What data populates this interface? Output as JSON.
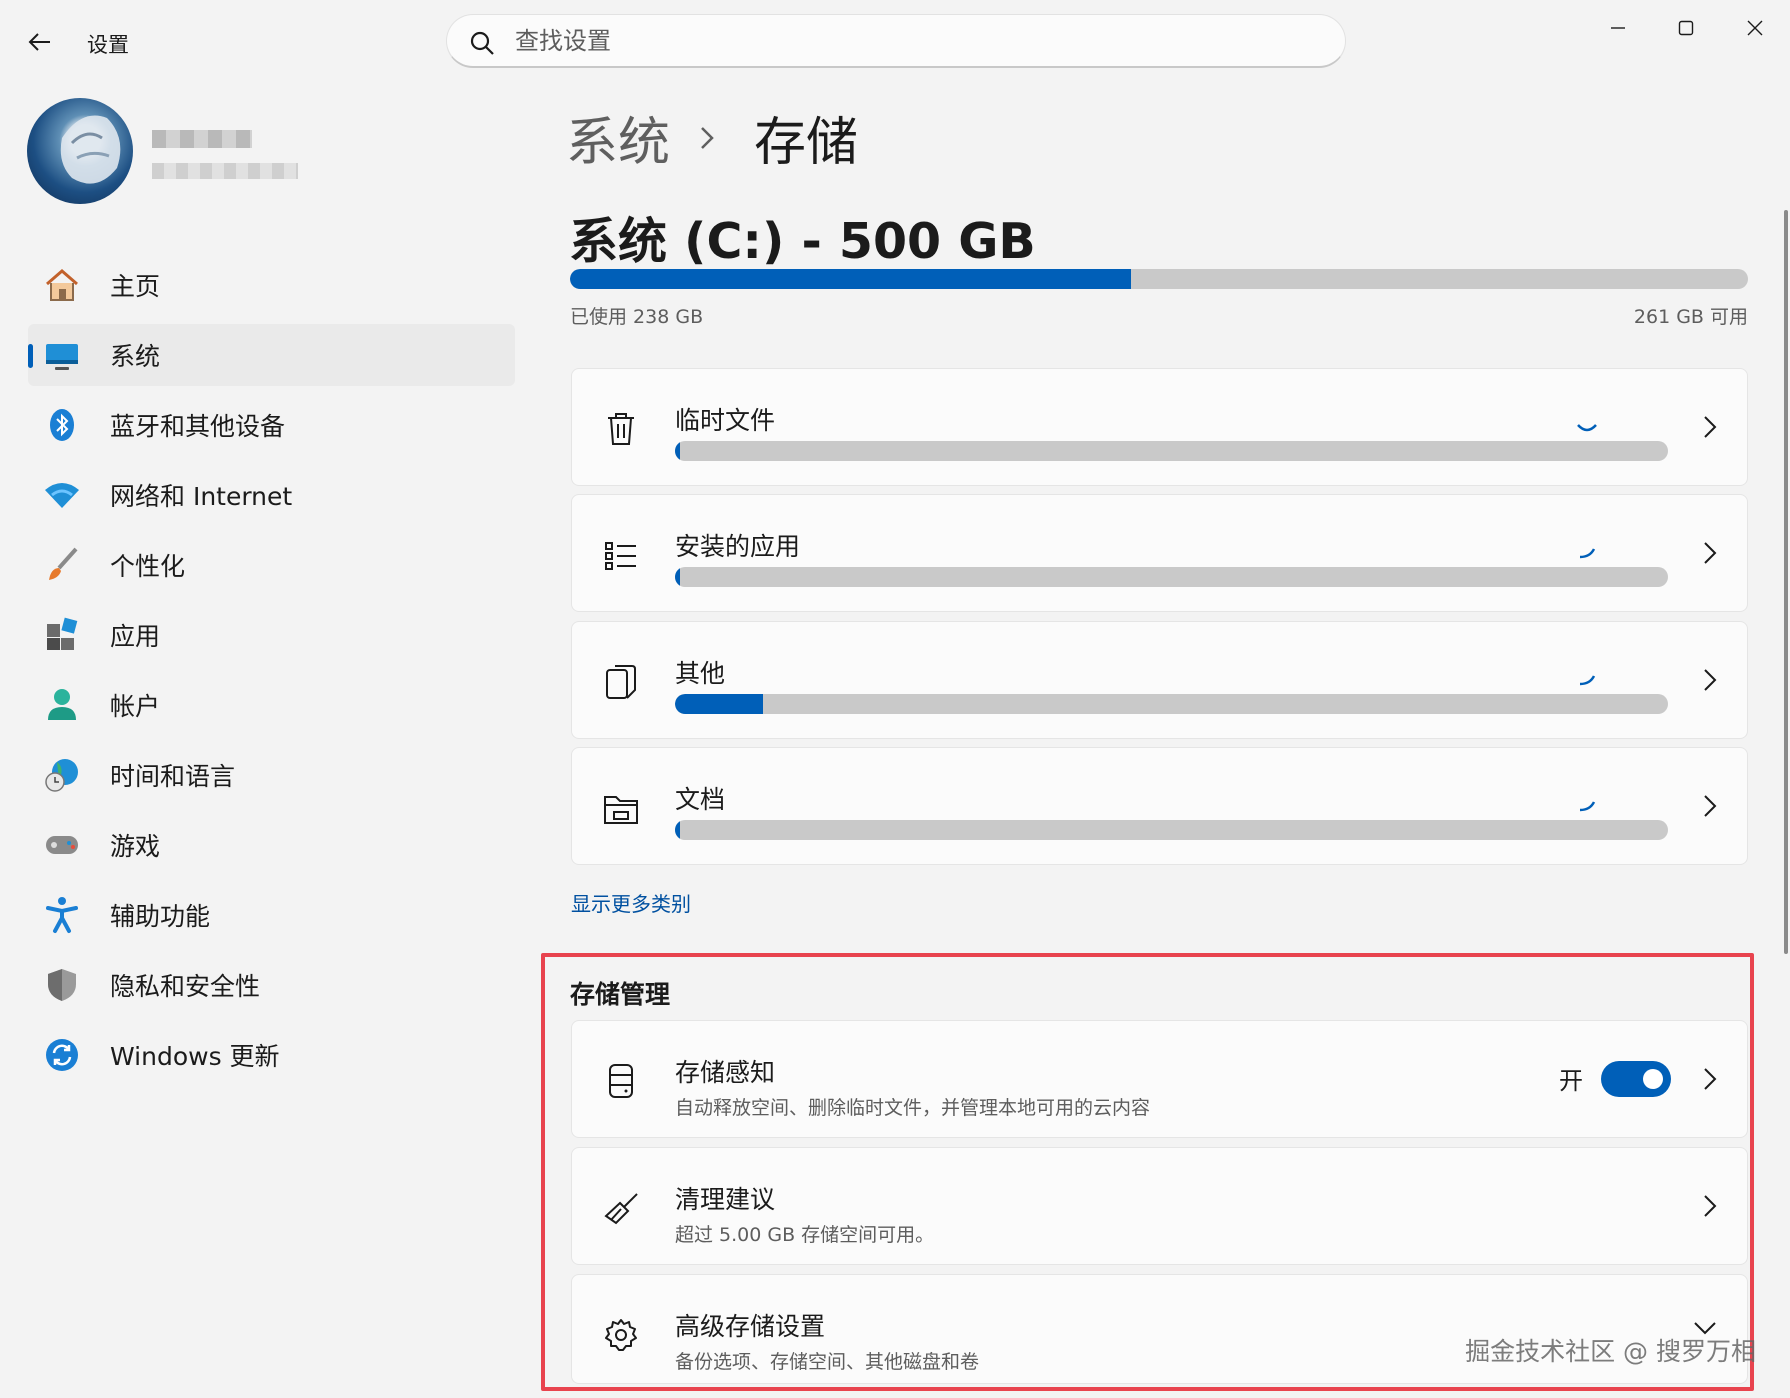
{
  "window": {
    "title": "设置",
    "search_placeholder": "查找设置"
  },
  "user": {
    "name_redacted": true,
    "email_redacted": true
  },
  "nav": {
    "items": [
      {
        "label": "主页",
        "icon": "home-icon",
        "active": false
      },
      {
        "label": "系统",
        "icon": "system-display-icon",
        "active": true
      },
      {
        "label": "蓝牙和其他设备",
        "icon": "bluetooth-icon",
        "active": false
      },
      {
        "label": "网络和 Internet",
        "icon": "wifi-icon",
        "active": false
      },
      {
        "label": "个性化",
        "icon": "paintbrush-icon",
        "active": false
      },
      {
        "label": "应用",
        "icon": "apps-icon",
        "active": false
      },
      {
        "label": "帐户",
        "icon": "account-icon",
        "active": false
      },
      {
        "label": "时间和语言",
        "icon": "globe-clock-icon",
        "active": false
      },
      {
        "label": "游戏",
        "icon": "gamepad-icon",
        "active": false
      },
      {
        "label": "辅助功能",
        "icon": "accessibility-icon",
        "active": false
      },
      {
        "label": "隐私和安全性",
        "icon": "shield-icon",
        "active": false
      },
      {
        "label": "Windows 更新",
        "icon": "update-icon",
        "active": false
      }
    ]
  },
  "breadcrumb": {
    "parent": "系统",
    "current": "存储"
  },
  "drive": {
    "title": "系统 (C:) - 500 GB",
    "used_label": "已使用 238 GB",
    "free_label": "261 GB 可用",
    "used_fraction": 0.476
  },
  "categories": [
    {
      "label": "临时文件",
      "icon": "trash-icon",
      "fraction": 0.003
    },
    {
      "label": "安装的应用",
      "icon": "list-icon",
      "fraction": 0.003
    },
    {
      "label": "其他",
      "icon": "other-files-icon",
      "fraction": 0.089
    },
    {
      "label": "文档",
      "icon": "folder-icon",
      "fraction": 0.003
    }
  ],
  "more_link": "显示更多类别",
  "management": {
    "title": "存储管理",
    "items": [
      {
        "label": "存储感知",
        "desc": "自动释放空间、删除临时文件，并管理本地可用的云内容",
        "icon": "storage-sense-icon",
        "toggle_label": "开",
        "toggle_on": true
      },
      {
        "label": "清理建议",
        "desc": "超过 5.00 GB 存储空间可用。",
        "icon": "broom-icon"
      },
      {
        "label": "高级存储设置",
        "desc": "备份选项、存储空间、其他磁盘和卷",
        "icon": "gear-icon"
      }
    ]
  },
  "watermark": "掘金技术社区 @ 搜罗万相",
  "colors": {
    "accent": "#005fb8",
    "highlight_outline": "#e8434e",
    "bar_track": "#c9c9c9"
  }
}
